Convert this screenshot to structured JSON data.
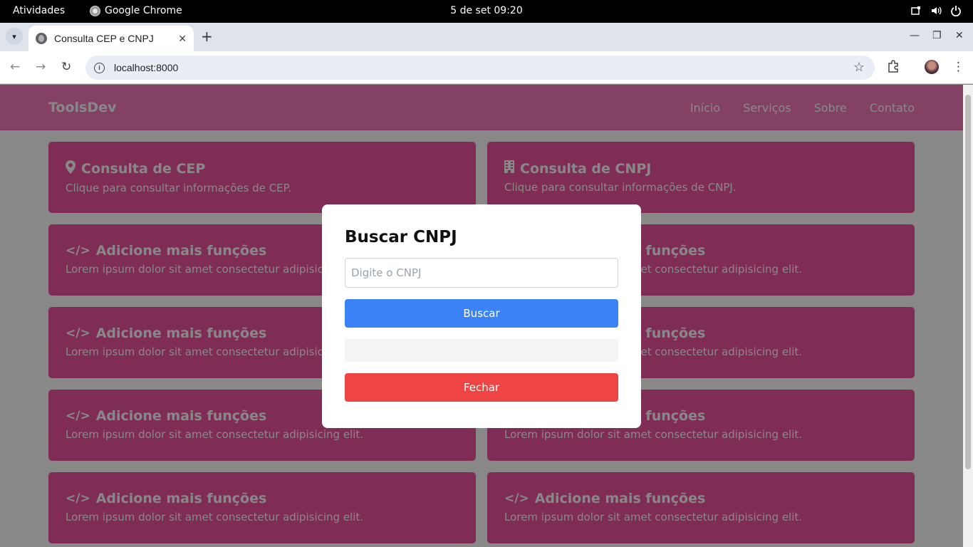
{
  "os": {
    "activities": "Atividades",
    "app_name": "Google Chrome",
    "clock": "5 de set  09:20"
  },
  "browser": {
    "tab_title": "Consulta CEP e CNPJ",
    "url": "localhost:8000"
  },
  "site": {
    "brand": "ToolsDev",
    "nav": [
      "Início",
      "Serviços",
      "Sobre",
      "Contato"
    ],
    "cards": [
      {
        "icon": "map-marker-icon",
        "title": "Consulta de CEP",
        "desc": "Clique para consultar informações de CEP."
      },
      {
        "icon": "building-icon",
        "title": "Consulta de CNPJ",
        "desc": "Clique para consultar informações de CNPJ."
      },
      {
        "icon": "code-icon",
        "title": "Adicione mais funções",
        "desc": "Lorem ipsum dolor sit amet consectetur adipisicing elit."
      },
      {
        "icon": "code-icon",
        "title": "Adicione mais funções",
        "desc": "Lorem ipsum dolor sit amet consectetur adipisicing elit."
      },
      {
        "icon": "code-icon",
        "title": "Adicione mais funções",
        "desc": "Lorem ipsum dolor sit amet consectetur adipisicing elit."
      },
      {
        "icon": "code-icon",
        "title": "Adicione mais funções",
        "desc": "Lorem ipsum dolor sit amet consectetur adipisicing elit."
      },
      {
        "icon": "code-icon",
        "title": "Adicione mais funções",
        "desc": "Lorem ipsum dolor sit amet consectetur adipisicing elit."
      },
      {
        "icon": "code-icon",
        "title": "Adicione mais funções",
        "desc": "Lorem ipsum dolor sit amet consectetur adipisicing elit."
      },
      {
        "icon": "code-icon",
        "title": "Adicione mais funções",
        "desc": "Lorem ipsum dolor sit amet consectetur adipisicing elit."
      },
      {
        "icon": "code-icon",
        "title": "Adicione mais funções",
        "desc": "Lorem ipsum dolor sit amet consectetur adipisicing elit."
      }
    ]
  },
  "modal": {
    "title": "Buscar CNPJ",
    "input_placeholder": "Digite o CNPJ",
    "input_value": "",
    "search_label": "Buscar",
    "result_text": "",
    "close_label": "Fechar"
  },
  "colors": {
    "navbar": "#f472b6",
    "card": "#ec4899",
    "search_button": "#3b82f6",
    "close_button": "#ef4444"
  }
}
